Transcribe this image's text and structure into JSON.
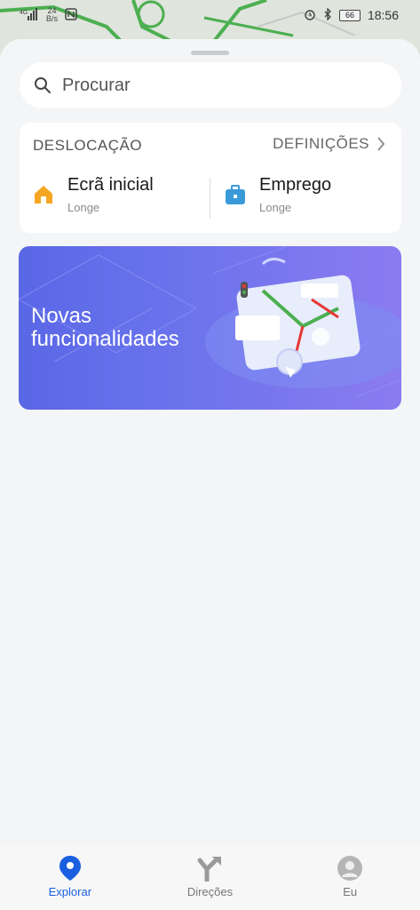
{
  "status_bar": {
    "signal": "4G",
    "speed_value": "24",
    "speed_unit": "B/s",
    "battery": "66",
    "time": "18:56",
    "icons": [
      "signal-icon",
      "nfc-icon",
      "alarm-icon",
      "bluetooth-icon",
      "battery-icon"
    ]
  },
  "search": {
    "placeholder": "Procurar"
  },
  "commute": {
    "title": "DESLOCAÇÃO",
    "settings_label": "DEFINIÇÕES",
    "home": {
      "name": "Ecrã inicial",
      "status": "Longe",
      "icon": "home-icon",
      "color": "#f5a623"
    },
    "work": {
      "name": "Emprego",
      "status": "Longe",
      "icon": "briefcase-icon",
      "color": "#3a9ad9"
    }
  },
  "banner": {
    "line1": "Novas",
    "line2": "funcionalidades"
  },
  "bottom_nav": {
    "active": "Explorar",
    "items": [
      {
        "label": "Explorar",
        "icon": "location-pin-icon"
      },
      {
        "label": "Direções",
        "icon": "directions-icon"
      },
      {
        "label": "Eu",
        "icon": "profile-icon"
      }
    ]
  },
  "colors": {
    "accent": "#1a5fe0",
    "banner_start": "#5a67e6",
    "banner_end": "#8b7bf0"
  }
}
